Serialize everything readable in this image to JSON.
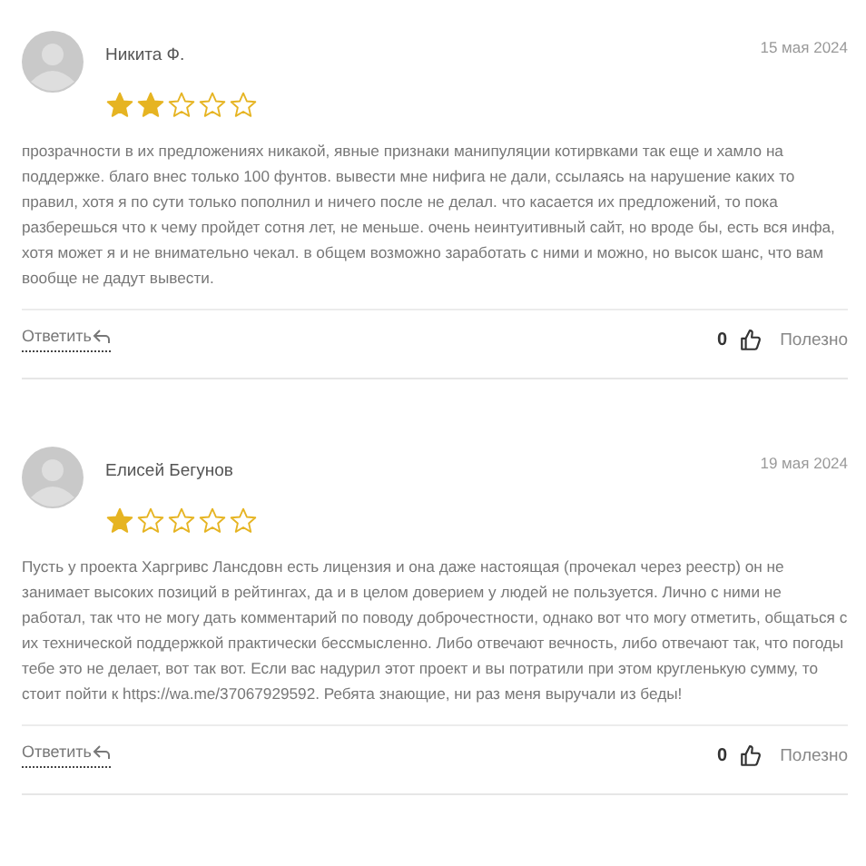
{
  "reviews": [
    {
      "author": "Никита Ф.",
      "date": "15 мая 2024",
      "stars": 2,
      "text": "прозрачности в их предложениях никакой, явные признаки манипуляции котирвками так еще и хамло на поддержке. благо внес только 100 фунтов. вывести мне нифига не дали, ссылаясь на нарушение каких то правил, хотя я по сути только пополнил и ничего после не делал. что касается их предложений, то пока разберешься что к чему пройдет сотня лет, не меньше. очень неинтуитивный сайт, но вроде бы, есть вся инфа, хотя может я и не внимательно чекал. в общем возможно заработать с ними и можно, но высок шанс, что вам вообще не дадут вывести.",
      "reply": "Ответить",
      "likes": "0",
      "useful": "Полезно"
    },
    {
      "author": "Елисей Бегунов",
      "date": "19 мая 2024",
      "stars": 1,
      "text": "Пусть у проекта Харгривс Лансдовн есть лицензия и она даже настоящая (прочекал через реестр) он не занимает высоких позиций в рейтингах, да и в целом доверием у людей не пользуется. Лично с ними не работал, так что не могу дать комментарий по поводу доброчестности, однако вот что могу отметить, общаться с их технической поддержкой практически бессмысленно. Либо отвечают вечность, либо отвечают так, что погоды тебе это не делает, вот так вот. Если вас надурил этот проект и вы потратили при этом кругленькую сумму, то стоит пойти к https://wa.me/37067929592. Ребята знающие, ни раз меня выручали из беды!",
      "reply": "Ответить",
      "likes": "0",
      "useful": "Полезно"
    }
  ]
}
